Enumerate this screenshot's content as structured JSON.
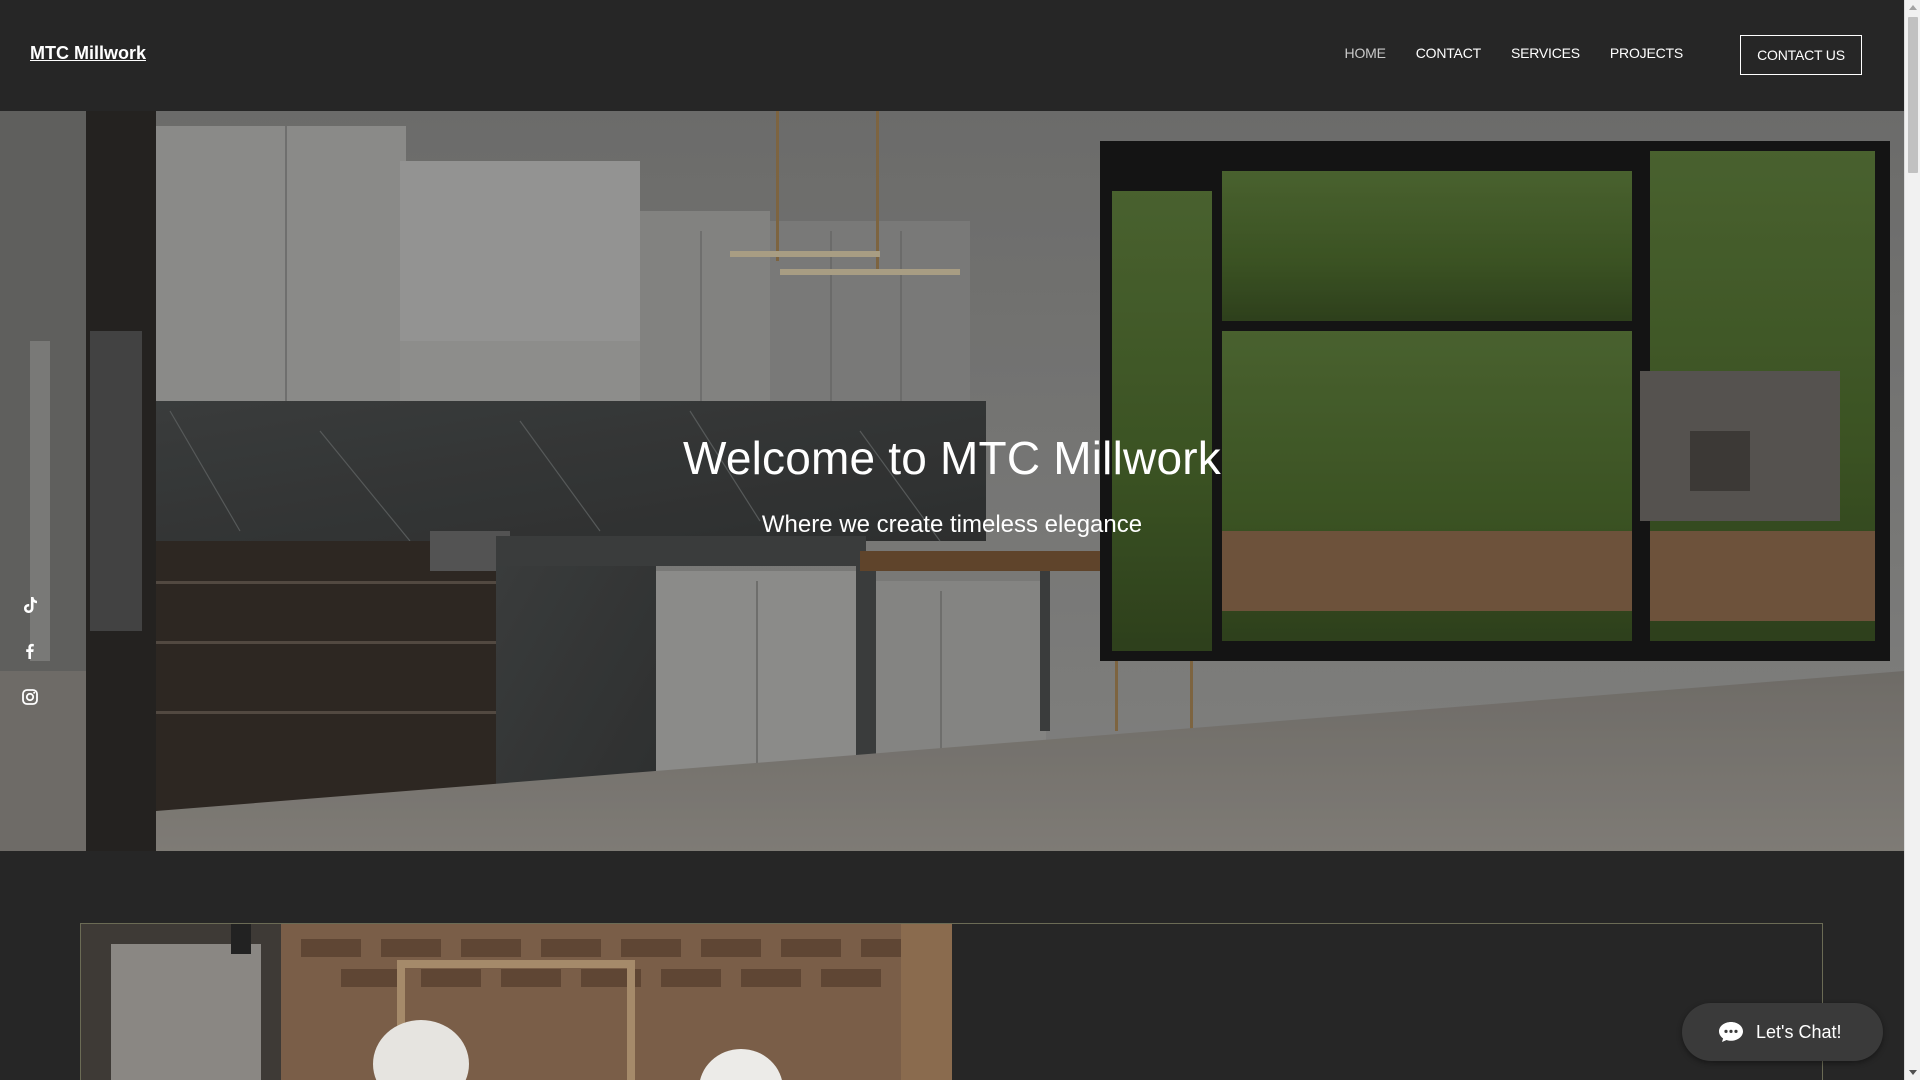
{
  "header": {
    "logo": "MTC Millwork",
    "nav": [
      {
        "label": "HOME",
        "active": true
      },
      {
        "label": "CONTACT",
        "active": false
      },
      {
        "label": "SERVICES",
        "active": false
      },
      {
        "label": "PROJECTS",
        "active": false
      }
    ],
    "cta_label": "CONTACT US"
  },
  "hero": {
    "title": "Welcome to MTC Millwork",
    "subtitle": "Where we create timeless elegance",
    "image_description_icon": "kitchen-photo"
  },
  "social": [
    {
      "icon": "tiktok-icon"
    },
    {
      "icon": "facebook-icon"
    },
    {
      "icon": "instagram-icon"
    }
  ],
  "chat": {
    "label": "Let's Chat!",
    "icon": "chat-bubble-icon"
  },
  "colors": {
    "header_bg": "#262626",
    "text": "#ffffff",
    "active_nav": "#c9c9c9",
    "chat_bg": "#3a3a3a"
  }
}
